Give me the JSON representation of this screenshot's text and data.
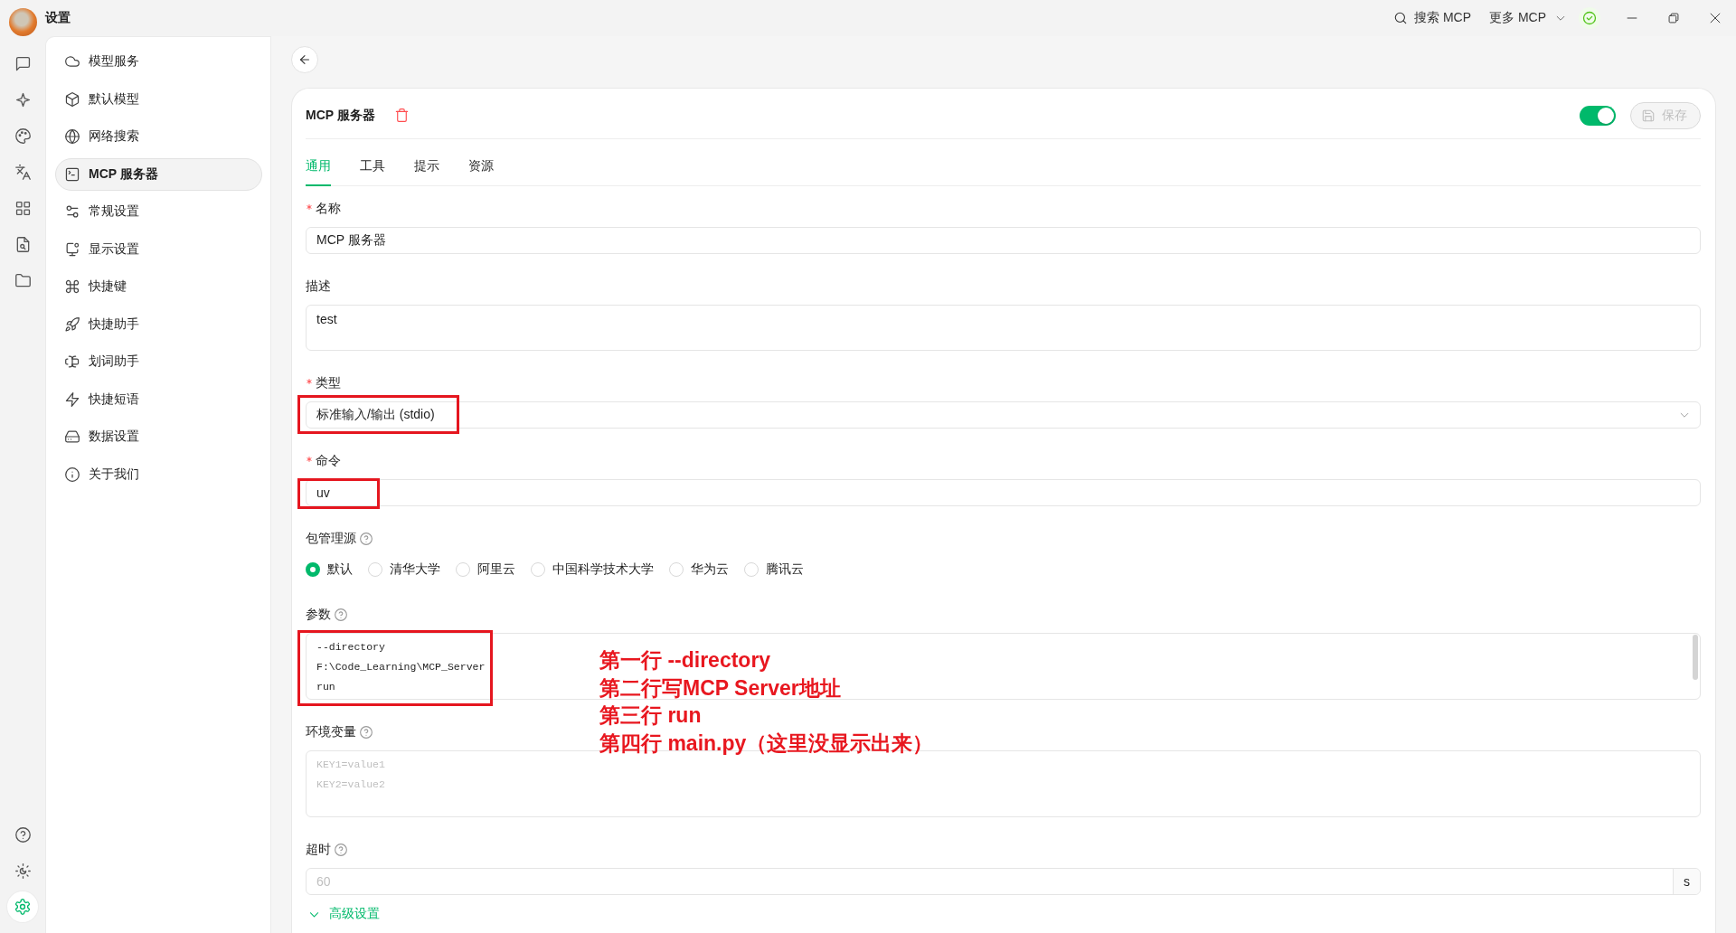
{
  "title_bar": {
    "title": "设置",
    "search_label": "搜索 MCP",
    "more_label": "更多 MCP"
  },
  "icon_rail": {
    "items": [
      {
        "selected": false
      },
      {
        "selected": false
      },
      {
        "selected": false
      },
      {
        "selected": false
      },
      {
        "selected": false
      },
      {
        "selected": false
      },
      {
        "selected": false
      }
    ],
    "bottom_items": [
      {
        "selected": false
      },
      {
        "selected": false
      },
      {
        "selected": true
      }
    ]
  },
  "settings_menu": {
    "items": [
      {
        "label": "模型服务",
        "selected": false
      },
      {
        "label": "默认模型",
        "selected": false
      },
      {
        "label": "网络搜索",
        "selected": false
      },
      {
        "label": "MCP 服务器",
        "selected": true
      },
      {
        "label": "常规设置",
        "selected": false
      },
      {
        "label": "显示设置",
        "selected": false
      },
      {
        "label": "快捷键",
        "selected": false
      },
      {
        "label": "快捷助手",
        "selected": false
      },
      {
        "label": "划词助手",
        "selected": false
      },
      {
        "label": "快捷短语",
        "selected": false
      },
      {
        "label": "数据设置",
        "selected": false
      },
      {
        "label": "关于我们",
        "selected": false
      }
    ]
  },
  "server": {
    "title": "MCP 服务器",
    "enabled": true,
    "save_button": {
      "label": "保存",
      "disabled": true
    },
    "tabs": [
      {
        "label": "通用",
        "selected": true
      },
      {
        "label": "工具",
        "selected": false
      },
      {
        "label": "提示",
        "selected": false
      },
      {
        "label": "资源",
        "selected": false
      }
    ],
    "fields": [
      {
        "kind": "input",
        "label": "名称",
        "required": true,
        "help": false,
        "highlighted": false,
        "value": "MCP 服务器"
      },
      {
        "kind": "textarea",
        "label": "描述",
        "required": false,
        "help": false,
        "highlighted": false,
        "value": "test"
      },
      {
        "kind": "select",
        "label": "类型",
        "required": true,
        "help": false,
        "highlighted": true,
        "value": "标准输入/输出 (stdio)"
      },
      {
        "kind": "input",
        "label": "命令",
        "required": true,
        "help": false,
        "highlighted": true,
        "value": "uv"
      },
      {
        "kind": "radio",
        "label": "包管理源",
        "required": false,
        "help": true,
        "highlighted": false,
        "options": [
          {
            "label": "默认",
            "selected": true
          },
          {
            "label": "清华大学",
            "selected": false
          },
          {
            "label": "阿里云",
            "selected": false
          },
          {
            "label": "中国科学技术大学",
            "selected": false
          },
          {
            "label": "华为云",
            "selected": false
          },
          {
            "label": "腾讯云",
            "selected": false
          }
        ]
      },
      {
        "kind": "code",
        "label": "参数",
        "required": false,
        "help": true,
        "highlighted": true,
        "value": "--directory\nF:\\Code_Learning\\MCP_Server\nrun"
      },
      {
        "kind": "code",
        "label": "环境变量",
        "required": false,
        "help": true,
        "highlighted": false,
        "placeholder": "KEY1=value1\nKEY2=value2"
      },
      {
        "kind": "input",
        "label": "超时",
        "required": false,
        "help": true,
        "highlighted": false,
        "placeholder": "60",
        "suffix": "s"
      }
    ],
    "advanced_label": "高级设置"
  },
  "annotation": {
    "lines": [
      "第一行 --directory",
      "第二行写MCP Server地址",
      "第三行 run",
      "第四行 main.py（这里没显示出来）"
    ]
  }
}
